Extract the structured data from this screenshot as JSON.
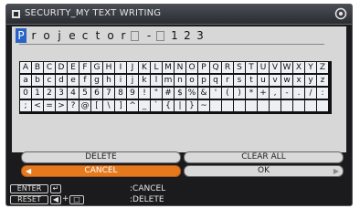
{
  "window": {
    "title": "SECURITY_MY TEXT WRITING"
  },
  "text_field": {
    "chars": [
      "P",
      "r",
      "o",
      "j",
      "e",
      "c",
      "t",
      "o",
      "r",
      "",
      "-",
      "",
      "1",
      "2",
      "3"
    ]
  },
  "keyboard": {
    "rows": [
      [
        "A",
        "B",
        "C",
        "D",
        "E",
        "F",
        "G",
        "H",
        "I",
        "J",
        "K",
        "L",
        "M",
        "N",
        "O",
        "P",
        "Q",
        "R",
        "S",
        "T",
        "U",
        "V",
        "W",
        "X",
        "Y",
        "Z"
      ],
      [
        "a",
        "b",
        "c",
        "d",
        "e",
        "f",
        "g",
        "h",
        "i",
        "j",
        "k",
        "l",
        "m",
        "n",
        "o",
        "p",
        "q",
        "r",
        "s",
        "t",
        "u",
        "v",
        "w",
        "x",
        "y",
        "z"
      ],
      [
        "0",
        "1",
        "2",
        "3",
        "4",
        "5",
        "6",
        "7",
        "8",
        "9",
        "!",
        "\"",
        "#",
        "$",
        "%",
        "&",
        "'",
        "(",
        ")",
        "*",
        "+",
        ",",
        "-",
        ".",
        "/",
        ":"
      ],
      [
        ";",
        "<",
        "=",
        ">",
        "?",
        "@",
        "[",
        "\\",
        "]",
        "^",
        "_",
        "`",
        "{",
        "|",
        "}",
        "~",
        "",
        "",
        "",
        "",
        "",
        "",
        "",
        "",
        "",
        ""
      ]
    ]
  },
  "buttons": {
    "delete": "DELETE",
    "clear_all": "CLEAR ALL",
    "cancel": "CANCEL",
    "ok": "OK"
  },
  "help": {
    "enter_key": "ENTER",
    "enter_action": ":CANCEL",
    "reset_key": "RESET",
    "reset_action": ":DELETE"
  },
  "colors": {
    "accent": "#e5791e",
    "cursor": "#2a63c7"
  }
}
